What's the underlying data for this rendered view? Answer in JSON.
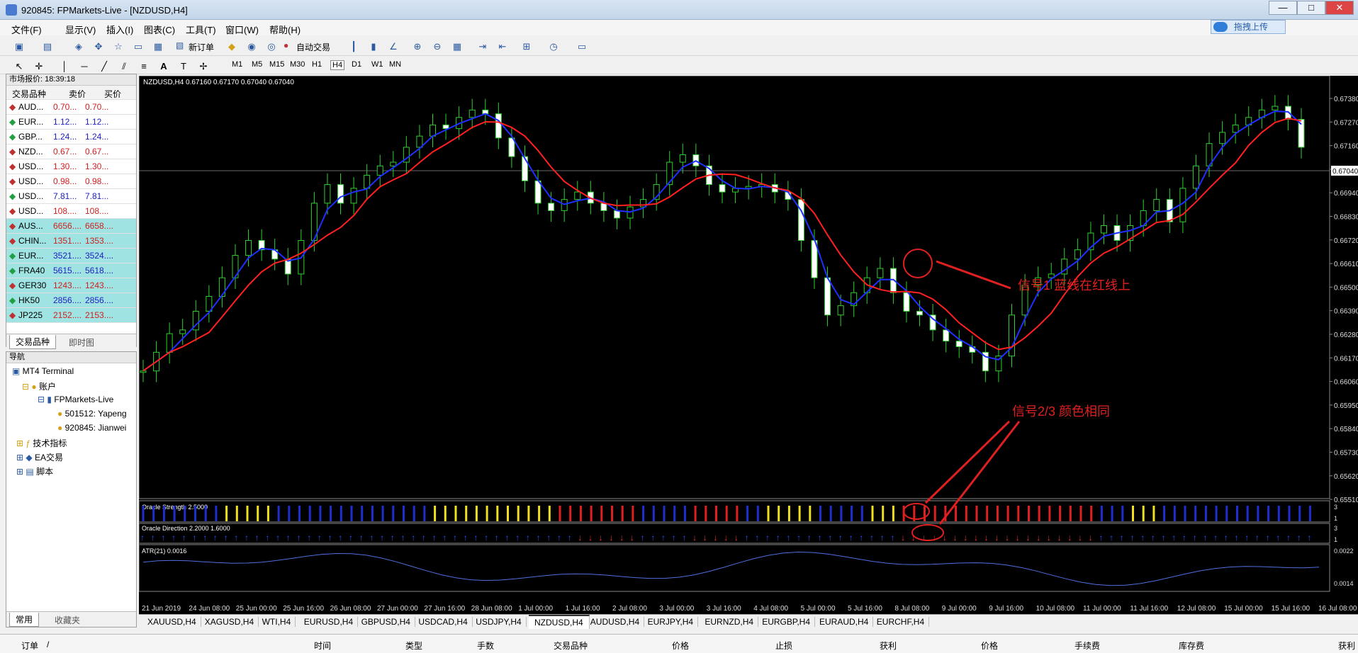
{
  "window": {
    "title": "920845: FPMarkets-Live - [NZDUSD,H4]",
    "min": "—",
    "max": "□",
    "close": "✕"
  },
  "menu": [
    "文件(F)",
    "显示(V)",
    "插入(I)",
    "图表(C)",
    "工具(T)",
    "窗口(W)",
    "帮助(H)"
  ],
  "toolbar": {
    "new_order": "新订单",
    "auto_trade": "自动交易",
    "upload": "拖拽上传"
  },
  "timeframes": [
    "M1",
    "M5",
    "M15",
    "M30",
    "H1",
    "H4",
    "D1",
    "W1",
    "MN"
  ],
  "market_watch": {
    "title": "市场报价: 18:39:18",
    "headers": [
      "交易品种",
      "卖价",
      "买价"
    ],
    "rows": [
      {
        "sym": "AUD...",
        "bid": "0.70...",
        "ask": "0.70...",
        "c": "#d02020"
      },
      {
        "sym": "EUR...",
        "bid": "1.12...",
        "ask": "1.12...",
        "c": "#2020c0"
      },
      {
        "sym": "GBP...",
        "bid": "1.24...",
        "ask": "1.24...",
        "c": "#2020c0"
      },
      {
        "sym": "NZD...",
        "bid": "0.67...",
        "ask": "0.67...",
        "c": "#d02020"
      },
      {
        "sym": "USD...",
        "bid": "1.30...",
        "ask": "1.30...",
        "c": "#d02020"
      },
      {
        "sym": "USD...",
        "bid": "0.98...",
        "ask": "0.98...",
        "c": "#d02020"
      },
      {
        "sym": "USD...",
        "bid": "7.81...",
        "ask": "7.81...",
        "c": "#2020c0"
      },
      {
        "sym": "USD...",
        "bid": "108....",
        "ask": "108....",
        "c": "#d02020"
      },
      {
        "sym": "AUS...",
        "bid": "6656....",
        "ask": "6658....",
        "c": "#d02020"
      },
      {
        "sym": "CHIN...",
        "bid": "1351....",
        "ask": "1353....",
        "c": "#d02020"
      },
      {
        "sym": "EUR...",
        "bid": "3521....",
        "ask": "3524....",
        "c": "#2020c0"
      },
      {
        "sym": "FRA40",
        "bid": "5615....",
        "ask": "5618....",
        "c": "#2020c0"
      },
      {
        "sym": "GER30",
        "bid": "1243....",
        "ask": "1243....",
        "c": "#d02020"
      },
      {
        "sym": "HK50",
        "bid": "2856....",
        "ask": "2856....",
        "c": "#2020c0"
      },
      {
        "sym": "JP225",
        "bid": "2152....",
        "ask": "2153....",
        "c": "#d02020"
      }
    ],
    "tabs": [
      "交易品种",
      "即时图"
    ]
  },
  "navigator": {
    "title": "导航",
    "items": [
      "MT4 Terminal",
      "账户",
      "FPMarkets-Live",
      "501512: Yapeng",
      "920845: Jianwei",
      "技术指标",
      "EA交易",
      "脚本"
    ],
    "tabs": [
      "常用",
      "收藏夹"
    ]
  },
  "chart": {
    "header": "NZDUSD,H4  0.67160 0.67170 0.67040 0.67040",
    "price_ticks": [
      "0.67380",
      "0.67270",
      "0.67160",
      "0.67040",
      "0.66940",
      "0.66830",
      "0.66720",
      "0.66610",
      "0.66500",
      "0.66390",
      "0.66280",
      "0.66170",
      "0.66060",
      "0.65950",
      "0.65840",
      "0.65730",
      "0.65620",
      "0.65510"
    ],
    "current_price": "0.67040",
    "time_ticks": [
      "21 Jun 2019",
      "24 Jun 08:00",
      "25 Jun 00:00",
      "25 Jun 16:00",
      "26 Jun 08:00",
      "27 Jun 00:00",
      "27 Jun 16:00",
      "28 Jun 08:00",
      "1 Jul 00:00",
      "1 Jul 16:00",
      "2 Jul 08:00",
      "3 Jul 00:00",
      "3 Jul 16:00",
      "4 Jul 08:00",
      "5 Jul 00:00",
      "5 Jul 16:00",
      "8 Jul 08:00",
      "9 Jul 00:00",
      "9 Jul 16:00",
      "10 Jul 08:00",
      "11 Jul 00:00",
      "11 Jul 16:00",
      "12 Jul 08:00",
      "15 Jul 00:00",
      "15 Jul 16:00",
      "16 Jul 08:00"
    ],
    "strength_label": "Oracle Strength 2.5000",
    "strength_ticks": [
      "3",
      "1"
    ],
    "direction_label": "Oracle Direction 2.2000 1.6000",
    "direction_ticks": [
      "3",
      "1"
    ],
    "atr_label": "ATR(21) 0.0016",
    "atr_ticks": [
      "0.0022",
      "0.0014"
    ],
    "annotation1": "信号1 蓝线在红线上",
    "annotation2": "信号2/3 颜色相同"
  },
  "chart_tabs": [
    "XAUUSD,H4",
    "XAGUSD,H4",
    "WTI,H4",
    "EURUSD,H4",
    "GBPUSD,H4",
    "USDCAD,H4",
    "USDJPY,H4",
    "NZDUSD,H4",
    "AUDUSD,H4",
    "EURJPY,H4",
    "EURNZD,H4",
    "EURGBP,H4",
    "EURAUD,H4",
    "EURCHF,H4"
  ],
  "active_tab": "NZDUSD,H4",
  "terminal_headers": [
    "订单",
    "/",
    "时间",
    "类型",
    "手数",
    "交易品种",
    "价格",
    "止损",
    "获利",
    "价格",
    "手续费",
    "库存费",
    "获利"
  ]
}
